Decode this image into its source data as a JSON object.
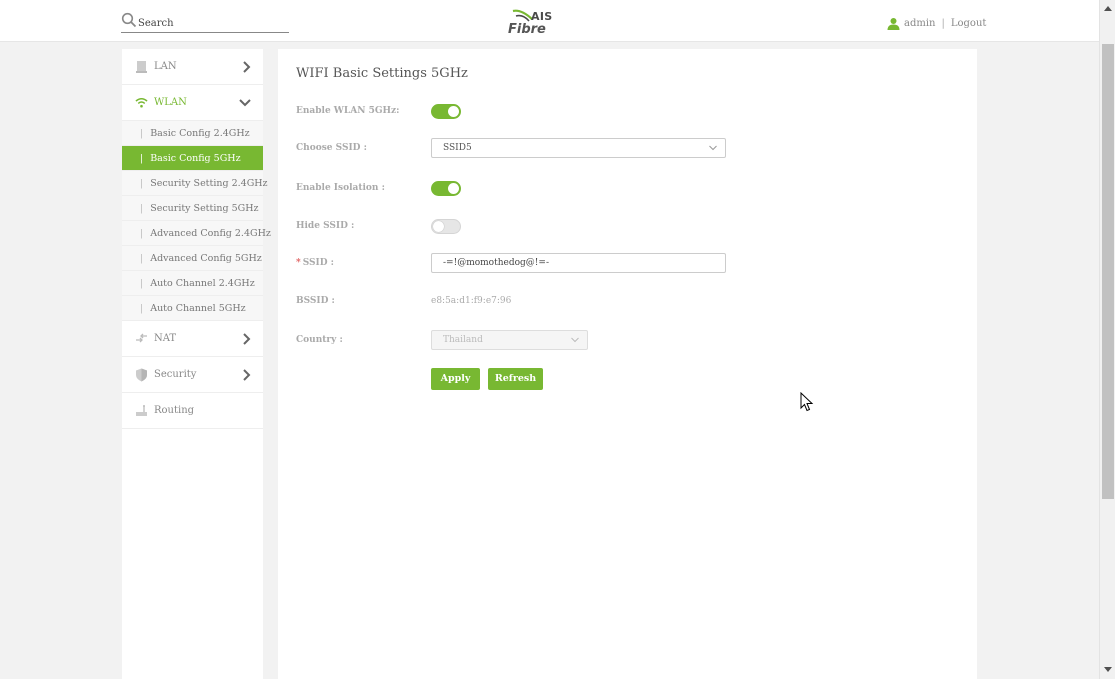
{
  "header": {
    "search_placeholder": "Search",
    "logo_top": "AIS",
    "logo_bottom": "Fibre",
    "user": "admin",
    "separator": "|",
    "logout": "Logout"
  },
  "colors": {
    "accent": "#78b832",
    "required": "#e06060"
  },
  "sidebar": {
    "lan": "LAN",
    "wlan": "WLAN",
    "wlan_sub": [
      "Basic Config 2.4GHz",
      "Basic Config 5GHz",
      "Security Setting 2.4GHz",
      "Security Setting 5GHz",
      "Advanced Config 2.4GHz",
      "Advanced Config 5GHz",
      "Auto Channel 2.4GHz",
      "Auto Channel 5GHz"
    ],
    "selected": "Basic Config 5GHz",
    "nat": "NAT",
    "security": "Security",
    "routing": "Routing"
  },
  "main": {
    "title": "WIFI Basic Settings 5GHz",
    "enable_wlan_label": "Enable WLAN 5GHz:",
    "enable_wlan": true,
    "choose_ssid_label": "Choose SSID :",
    "choose_ssid_value": "SSID5",
    "enable_isolation_label": "Enable Isolation :",
    "enable_isolation": true,
    "hide_ssid_label": "Hide SSID :",
    "hide_ssid": false,
    "ssid_required_mark": "*",
    "ssid_label": "SSID :",
    "ssid_value": "-=!@momothedog@!=-",
    "bssid_label": "BSSID :",
    "bssid_value": "e8:5a:d1:f9:e7:96",
    "country_label": "Country :",
    "country_value": "Thailand",
    "apply_label": "Apply",
    "refresh_label": "Refresh"
  }
}
